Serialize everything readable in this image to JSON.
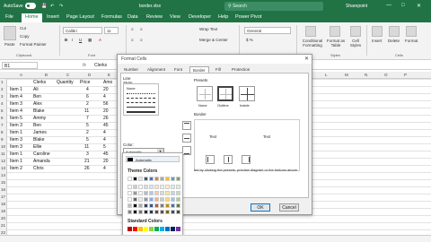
{
  "titlebar": {
    "autosave": "AutoSave",
    "title": "border.xlsx",
    "search": "Search",
    "user": "Sharepoint"
  },
  "tabs": [
    "File",
    "Home",
    "Insert",
    "Page Layout",
    "Formulas",
    "Data",
    "Review",
    "View",
    "Developer",
    "Help",
    "Power Pivot"
  ],
  "ribbon": {
    "paste": "Paste",
    "cut": "Cut",
    "copy": "Copy",
    "format_painter": "Format Painter",
    "clipboard": "Clipboard",
    "font_name": "Calibri",
    "font_size": "11",
    "font_group": "Font",
    "wrap": "Wrap Text",
    "merge": "Merge & Center",
    "alignment": "Alignment",
    "number_format": "General",
    "number": "Number",
    "cond": "Conditional Formatting",
    "fmt_table": "Format as Table",
    "cell_styles": "Cell Styles",
    "styles": "Styles",
    "insert": "Insert",
    "delete": "Delete",
    "format": "Format",
    "cells": "Cells"
  },
  "formula": {
    "namebox": "B1",
    "value": "Clerks"
  },
  "columns": [
    "A",
    "B",
    "C",
    "D",
    "E",
    "F",
    "G",
    "H",
    "I",
    "J",
    "K",
    "L",
    "M",
    "N",
    "O",
    "P",
    "Q",
    "R",
    "S"
  ],
  "rows": [
    "1",
    "2",
    "3",
    "4",
    "5",
    "6",
    "7",
    "8",
    "9",
    "10",
    "11",
    "12",
    "13",
    "14",
    "15",
    "16",
    "17",
    "18",
    "19",
    "20",
    "21",
    "22",
    "23"
  ],
  "table": {
    "headers": [
      "Clerks",
      "Quantity",
      "Price",
      "Amo"
    ],
    "rows": [
      [
        "Item 1",
        "Ali",
        "4",
        "20"
      ],
      [
        "Item 4",
        "Ben",
        "6",
        "4"
      ],
      [
        "Item 3",
        "Alex",
        "2",
        "56"
      ],
      [
        "Item 4",
        "Blake",
        "11",
        "20"
      ],
      [
        "Item 5",
        "Ammy",
        "7",
        "26"
      ],
      [
        "Item 3",
        "Ben",
        "5",
        "45"
      ],
      [
        "Item 1",
        "James",
        "2",
        "4"
      ],
      [
        "Item 3",
        "Blake",
        "5",
        "4"
      ],
      [
        "Item 3",
        "Ellie",
        "11",
        "5"
      ],
      [
        "Item 1",
        "Caroline",
        "3",
        "45"
      ],
      [
        "Item 1",
        "Amanda",
        "21",
        "20"
      ],
      [
        "Item 2",
        "Chris",
        "26",
        "4"
      ]
    ]
  },
  "dialog": {
    "title": "Format Cells",
    "tabs": [
      "Number",
      "Alignment",
      "Font",
      "Border",
      "Fill",
      "Protection"
    ],
    "line": "Line",
    "style": "Style:",
    "none": "None",
    "color": "Color:",
    "color_value": "Automatic",
    "presets": "Presets",
    "preset_labels": [
      "None",
      "Outline",
      "Inside"
    ],
    "border": "Border",
    "text": "Text",
    "hint": "ied by clicking the presets, preview diagram or the buttons above.",
    "ok": "OK",
    "cancel": "Cancel"
  },
  "palette": {
    "automatic": "Automatic",
    "theme": "Theme Colors",
    "standard": "Standard Colors",
    "more": "More Colors...",
    "theme_top": [
      "#ffffff",
      "#000000",
      "#e7e6e6",
      "#44546a",
      "#4472c4",
      "#ed7d31",
      "#a5a5a5",
      "#ffc000",
      "#5b9bd5",
      "#70ad47"
    ],
    "standard_colors": [
      "#c00000",
      "#ff0000",
      "#ffc000",
      "#ffff00",
      "#92d050",
      "#00b050",
      "#00b0f0",
      "#0070c0",
      "#002060",
      "#7030a0"
    ]
  }
}
